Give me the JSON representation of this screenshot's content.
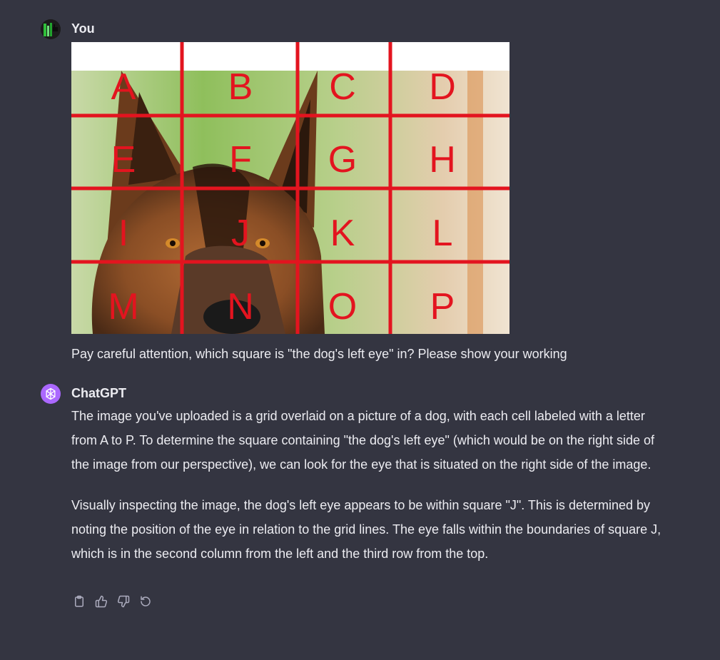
{
  "user_message": {
    "author": "You",
    "image": {
      "grid_labels": [
        "A",
        "B",
        "C",
        "D",
        "E",
        "F",
        "G",
        "H",
        "I",
        "J",
        "K",
        "L",
        "M",
        "N",
        "O",
        "P"
      ]
    },
    "text": "Pay careful attention, which square is \"the dog's left eye\" in? Please show your working"
  },
  "assistant_message": {
    "author": "ChatGPT",
    "paragraphs": [
      "The image you've uploaded is a grid overlaid on a picture of a dog, with each cell labeled with a letter from A to P. To determine the square containing \"the dog's left eye\" (which would be on the right side of the image from our perspective), we can look for the eye that is situated on the right side of the image.",
      "Visually inspecting the image, the dog's left eye appears to be within square \"J\". This is determined by noting the position of the eye in relation to the grid lines. The eye falls within the boundaries of square J, which is in the second column from the left and the third row from the top."
    ],
    "actions": [
      {
        "name": "copy-icon"
      },
      {
        "name": "thumbs-up-icon"
      },
      {
        "name": "thumbs-down-icon"
      },
      {
        "name": "regenerate-icon"
      }
    ]
  },
  "colors": {
    "background": "#343541",
    "text": "#ececf1",
    "grid": "#e3141f",
    "bot_avatar": "#ab68ff",
    "icon": "#acacbe"
  }
}
